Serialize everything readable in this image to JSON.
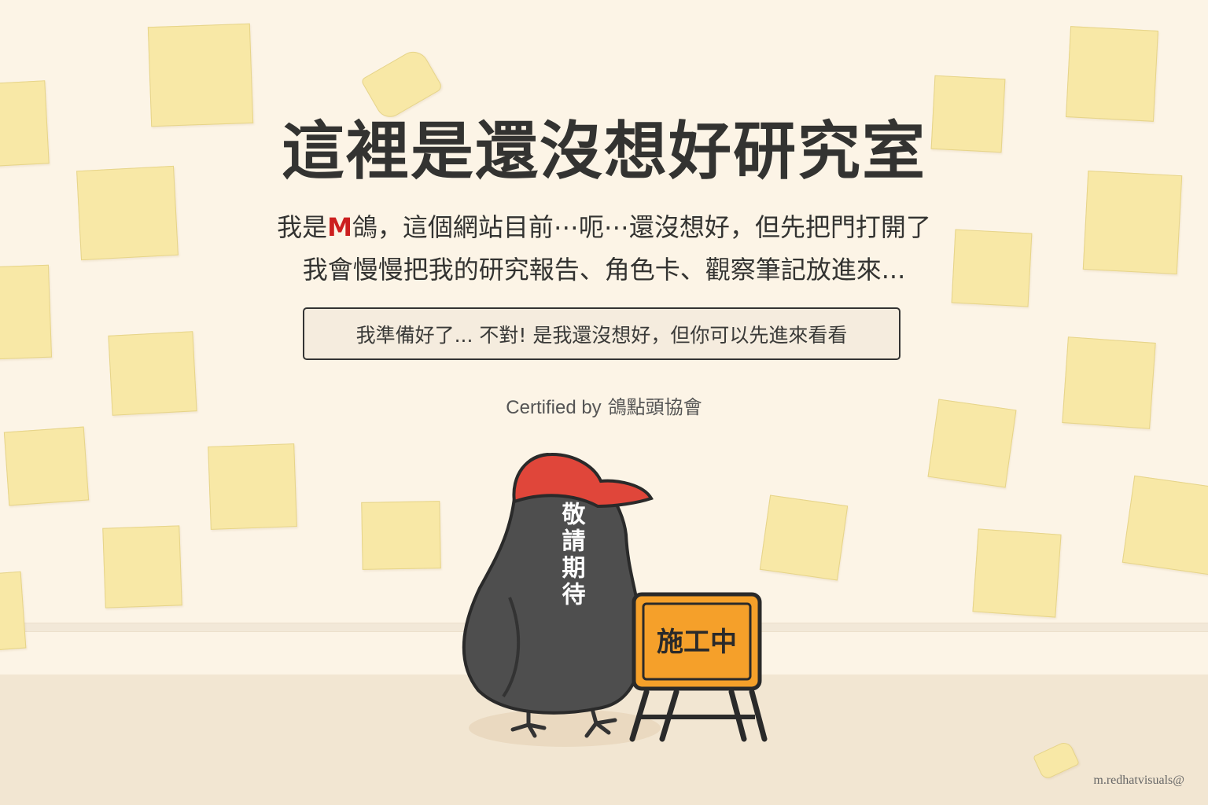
{
  "page": {
    "title": "這裡是還沒想好研究室",
    "intro_line1_prefix": "我是",
    "intro_line1_m": "M",
    "intro_line1_suffix": "鴿，這個網站目前⋯呃⋯還沒想好，但先把門打開了",
    "intro_line2": "我會慢慢把我的研究報告、角色卡、觀察筆記放進來..."
  },
  "enter_button": {
    "label": "我準備好了... 不對! 是我還沒想好，但你可以先進來看看"
  },
  "certification": {
    "prefix": "Certified by",
    "org": "鴿點頭協會"
  },
  "illustration": {
    "bird_label": "敬請期待",
    "sign_label": "施工中",
    "bird_color": "#4e4e4e",
    "cap_color": "#e0463a",
    "sign_color": "#f5a02a"
  },
  "watermark": "m.redhatvisuals@"
}
